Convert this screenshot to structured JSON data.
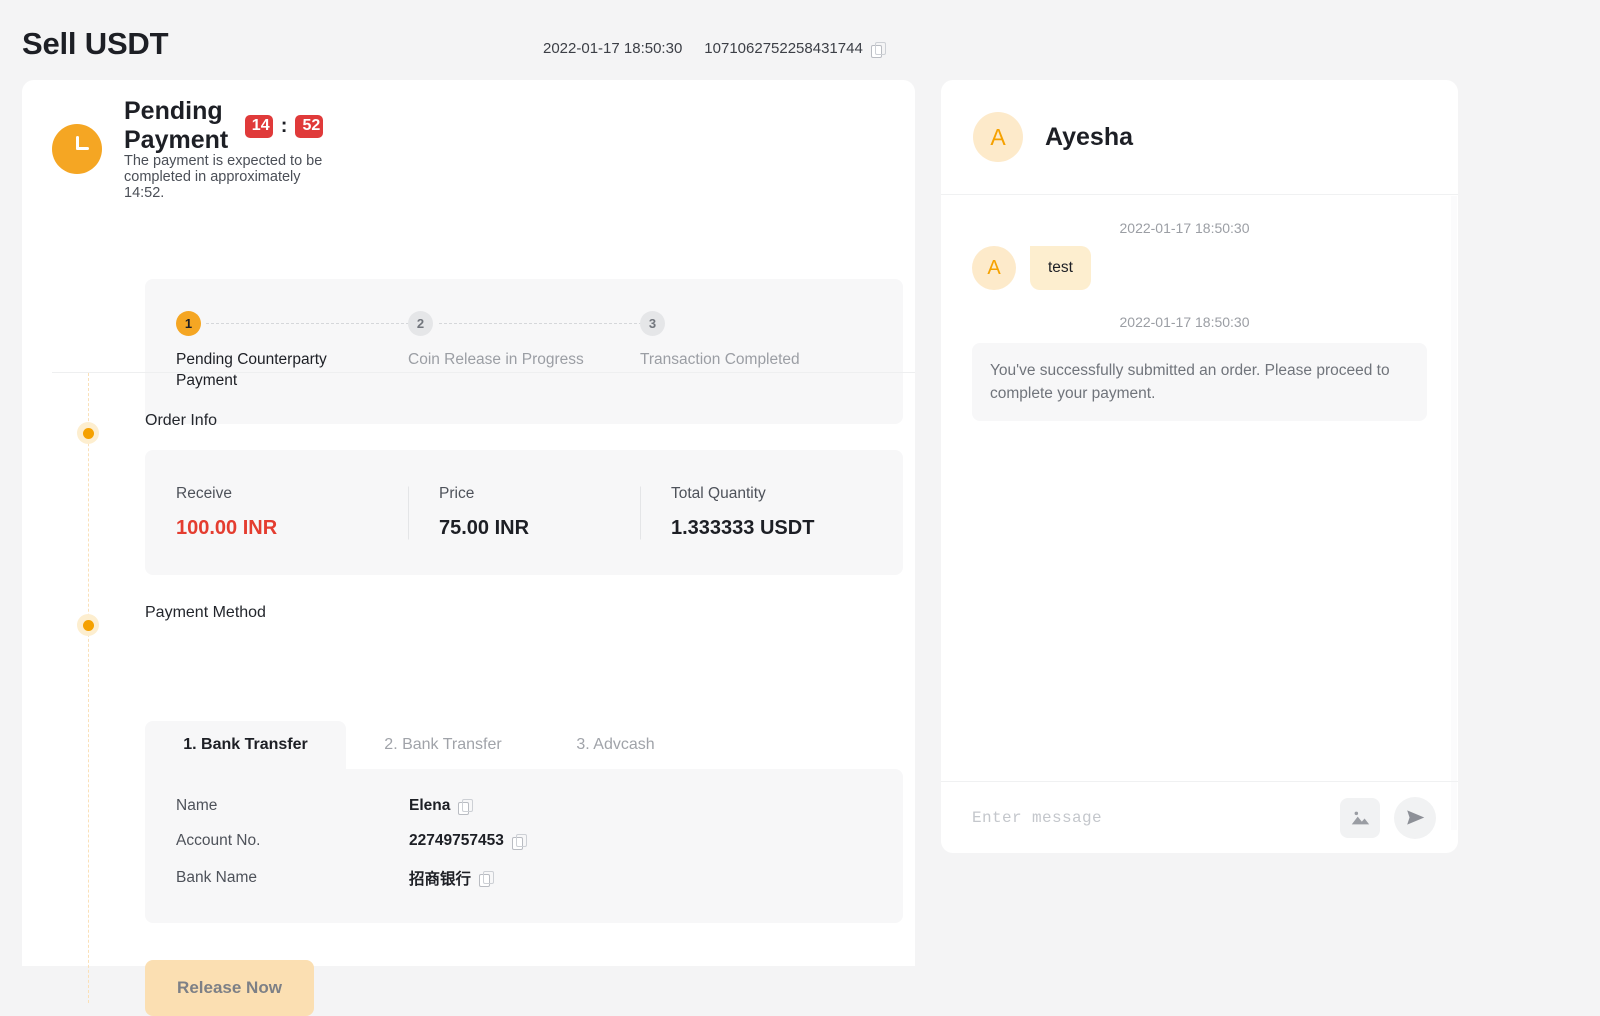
{
  "header": {
    "title": "Sell USDT",
    "timestamp": "2022-01-17 18:50:30",
    "order_id": "1071062752258431744",
    "copy_icon": "copy-icon"
  },
  "status": {
    "icon": "clock-icon",
    "title": "Pending Payment",
    "timer_minutes": "14",
    "timer_separator": ":",
    "timer_seconds": "52",
    "subtitle": "The payment is expected to be completed in approximately 14:52."
  },
  "stepper": {
    "steps": [
      {
        "number": "1",
        "label": "Pending Counterparty Payment",
        "state": "active"
      },
      {
        "number": "2",
        "label": "Coin Release in Progress",
        "state": "inactive"
      },
      {
        "number": "3",
        "label": "Transaction Completed",
        "state": "inactive"
      }
    ]
  },
  "order_info": {
    "section_label": "Order Info",
    "columns": [
      {
        "key": "Receive",
        "value": "100.00 INR",
        "highlight": true
      },
      {
        "key": "Price",
        "value": "75.00 INR",
        "highlight": false
      },
      {
        "key": "Total Quantity",
        "value": "1.333333 USDT",
        "highlight": false
      }
    ]
  },
  "payment_method": {
    "section_label": "Payment Method",
    "tabs": [
      {
        "label": "1. Bank Transfer",
        "active": true
      },
      {
        "label": "2. Bank Transfer",
        "active": false
      },
      {
        "label": "3. Advcash",
        "active": false
      }
    ],
    "rows": [
      {
        "key": "Name",
        "value": "Elena"
      },
      {
        "key": "Account No.",
        "value": "22749757453"
      },
      {
        "key": "Bank Name",
        "value": "招商银行"
      }
    ]
  },
  "actions": {
    "release_label": "Release Now"
  },
  "chat": {
    "avatar_initial": "A",
    "name": "Ayesha",
    "messages": [
      {
        "type": "peer",
        "timestamp": "2022-01-17 18:50:30",
        "avatar_initial": "A",
        "text": "test"
      },
      {
        "type": "system",
        "timestamp": "2022-01-17 18:50:30",
        "text": "You've successfully submitted an order. Please proceed to complete your payment."
      }
    ],
    "input_placeholder": "Enter message",
    "image_icon": "image-icon",
    "send_icon": "send-icon"
  },
  "colors": {
    "accent_orange": "#f5a623",
    "badge_red": "#e03a3a",
    "highlight_red": "#e43d30",
    "page_bg": "#f4f4f5",
    "card_bg": "#f7f7f8"
  }
}
